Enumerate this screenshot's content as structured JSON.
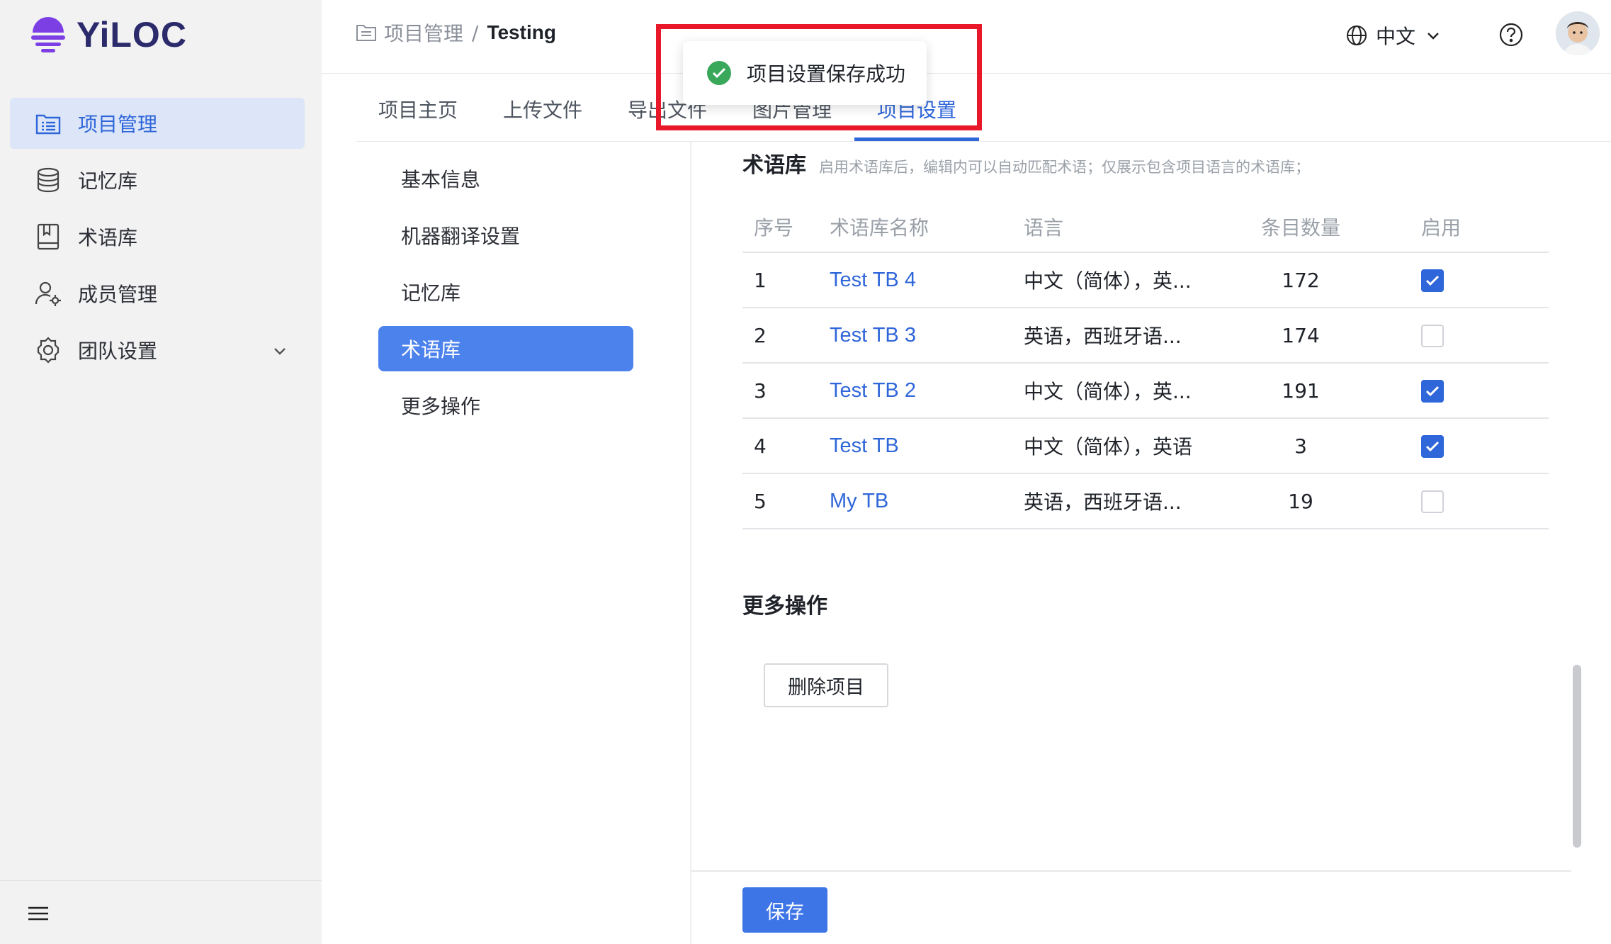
{
  "app": {
    "logo_text": "YiLOC",
    "brand_color": "#2f66d9"
  },
  "sidebar": {
    "items": [
      {
        "label": "项目管理",
        "icon": "folder-list-icon",
        "active": true
      },
      {
        "label": "记忆库",
        "icon": "database-icon",
        "active": false
      },
      {
        "label": "术语库",
        "icon": "book-icon",
        "active": false
      },
      {
        "label": "成员管理",
        "icon": "user-gear-icon",
        "active": false
      },
      {
        "label": "团队设置",
        "icon": "gear-icon",
        "active": false,
        "expandable": true
      }
    ]
  },
  "header": {
    "breadcrumb": {
      "root": "项目管理",
      "separator": "/",
      "current": "Testing"
    },
    "language": "中文"
  },
  "tabs": [
    {
      "label": "项目主页"
    },
    {
      "label": "上传文件"
    },
    {
      "label": "导出文件"
    },
    {
      "label": "图片管理"
    },
    {
      "label": "项目设置",
      "active": true
    }
  ],
  "subnav": [
    {
      "label": "基本信息"
    },
    {
      "label": "机器翻译设置"
    },
    {
      "label": "记忆库"
    },
    {
      "label": "术语库",
      "active": true
    },
    {
      "label": "更多操作"
    }
  ],
  "termbase": {
    "title": "术语库",
    "description": "启用术语库后，编辑内可以自动匹配术语；仅展示包含项目语言的术语库；",
    "columns": [
      "序号",
      "术语库名称",
      "语言",
      "条目数量",
      "启用"
    ],
    "rows": [
      {
        "idx": "1",
        "name": "Test TB 4",
        "langs": "中文（简体），英...",
        "count": "172",
        "enabled": true
      },
      {
        "idx": "2",
        "name": "Test TB 3",
        "langs": "英语，西班牙语...",
        "count": "174",
        "enabled": false
      },
      {
        "idx": "3",
        "name": "Test TB 2",
        "langs": "中文（简体），英...",
        "count": "191",
        "enabled": true
      },
      {
        "idx": "4",
        "name": "Test TB",
        "langs": "中文（简体），英语",
        "count": "3",
        "enabled": true
      },
      {
        "idx": "5",
        "name": "My TB",
        "langs": "英语，西班牙语...",
        "count": "19",
        "enabled": false
      }
    ]
  },
  "more_actions": {
    "title": "更多操作",
    "delete_label": "删除项目"
  },
  "footer": {
    "save_label": "保存"
  },
  "toast": {
    "message": "项目设置保存成功",
    "highlight_color": "#e8172a"
  }
}
